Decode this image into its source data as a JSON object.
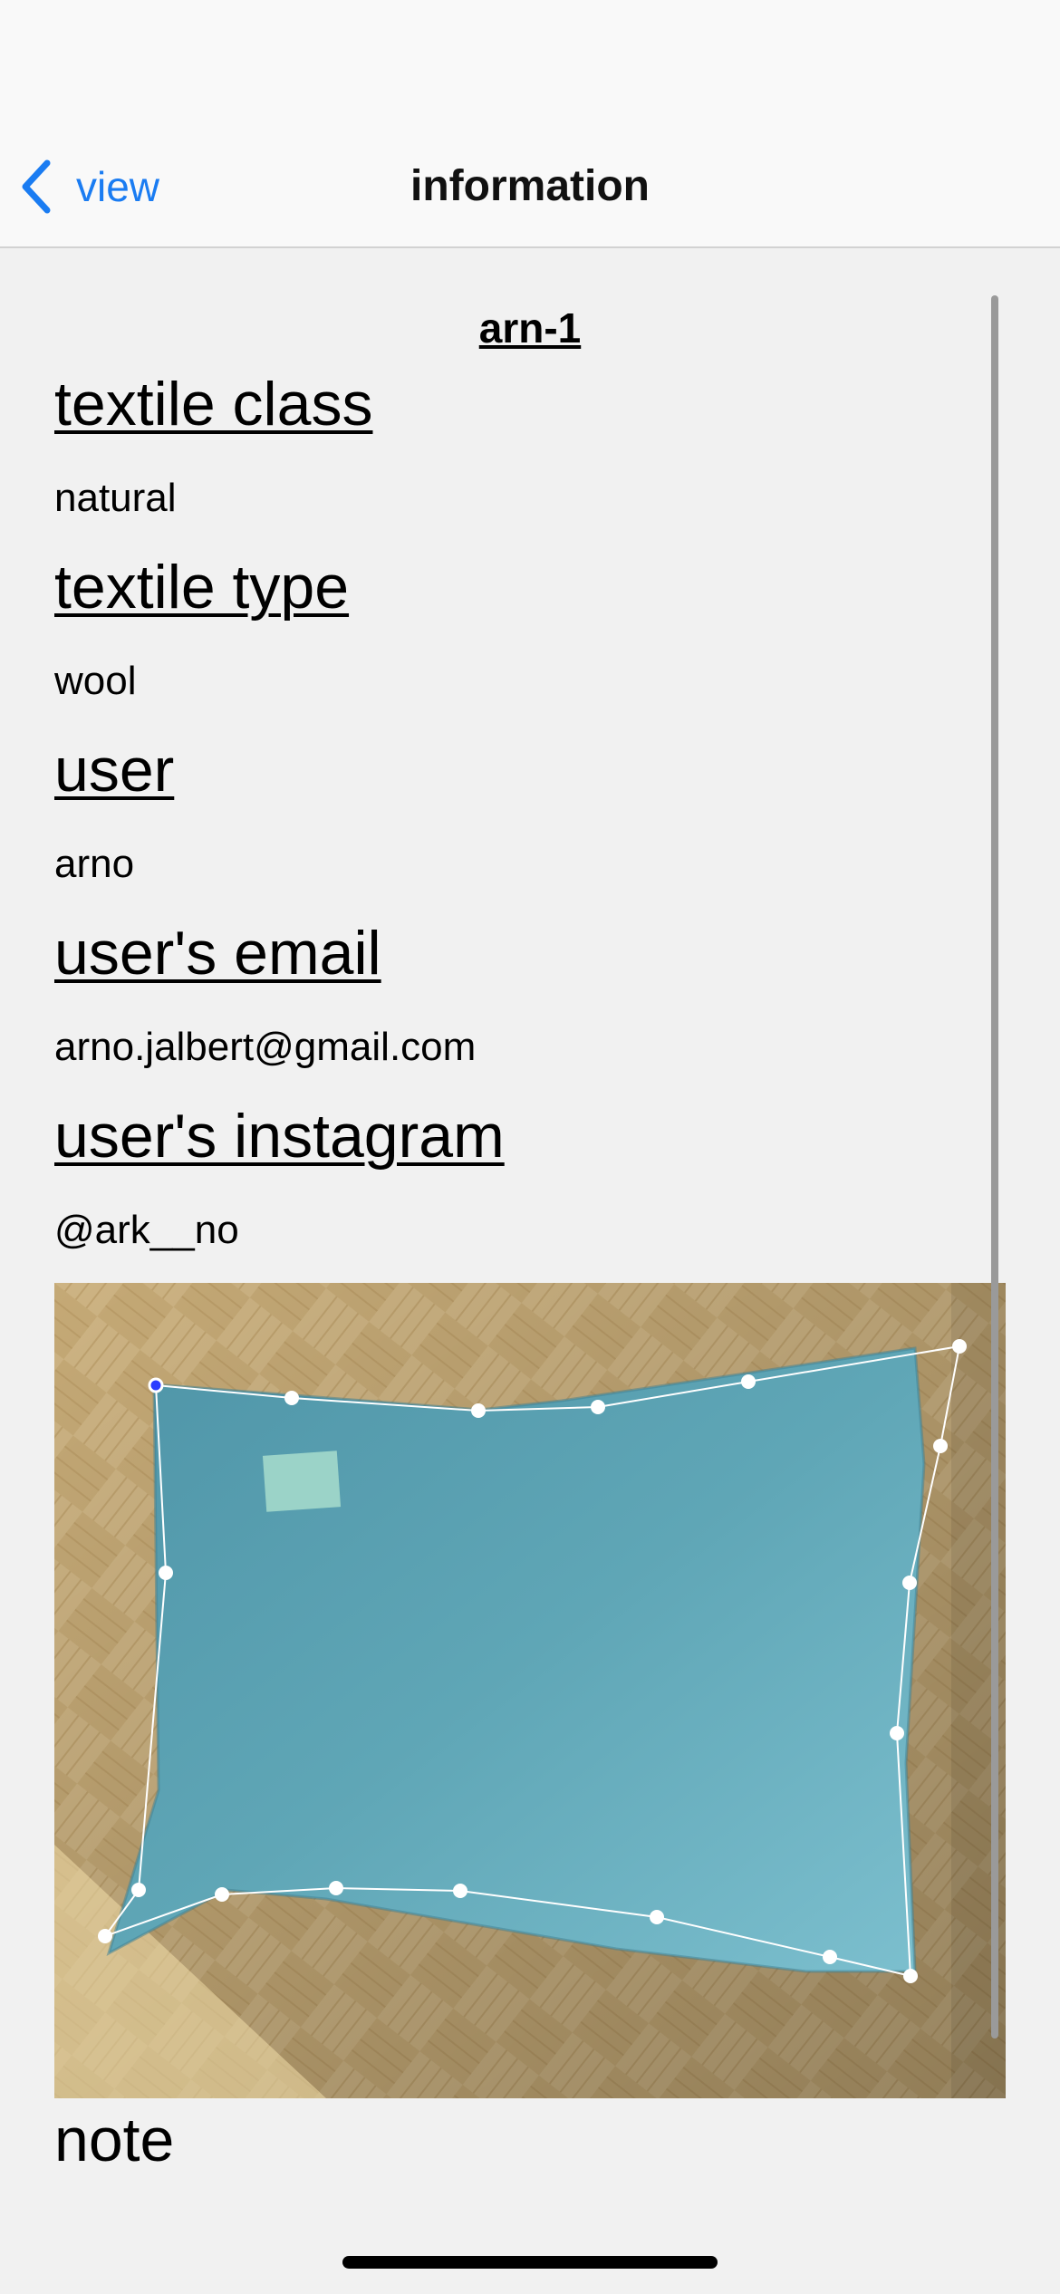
{
  "nav": {
    "back_label": "view",
    "title": "information"
  },
  "record": {
    "id": "arn-1"
  },
  "fields": [
    {
      "heading": "textile class",
      "value": "natural"
    },
    {
      "heading": "textile type",
      "value": "wool"
    },
    {
      "heading": "user",
      "value": "arno"
    },
    {
      "heading": "user's email",
      "value": "arno.jalbert@gmail.com"
    },
    {
      "heading": "user's instagram",
      "value": "@ark__no"
    }
  ],
  "note": {
    "heading": "note"
  },
  "photo": {
    "subject": "blue wool textile piece on parquet floor with measurement outline"
  },
  "colors": {
    "accent": "#1a7cf2",
    "background": "#f1f1f1",
    "textile": "#5fa6b6",
    "floor": "#d9c08e"
  }
}
